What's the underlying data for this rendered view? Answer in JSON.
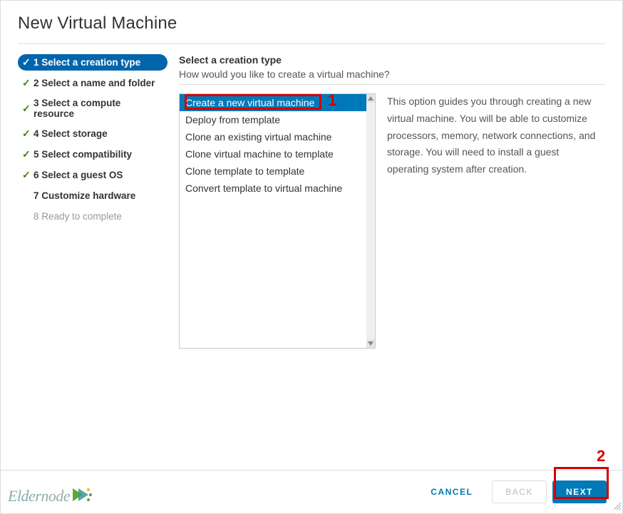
{
  "dialog": {
    "title": "New Virtual Machine"
  },
  "sidebar": {
    "steps": [
      {
        "num": "1",
        "label": "Select a creation type"
      },
      {
        "num": "2",
        "label": "Select a name and folder"
      },
      {
        "num": "3",
        "label": "Select a compute resource"
      },
      {
        "num": "4",
        "label": "Select storage"
      },
      {
        "num": "5",
        "label": "Select compatibility"
      },
      {
        "num": "6",
        "label": "Select a guest OS"
      },
      {
        "num": "7",
        "label": "Customize hardware"
      },
      {
        "num": "8",
        "label": "Ready to complete"
      }
    ]
  },
  "main": {
    "heading": "Select a creation type",
    "subheading": "How would you like to create a virtual machine?",
    "options": [
      "Create a new virtual machine",
      "Deploy from template",
      "Clone an existing virtual machine",
      "Clone virtual machine to template",
      "Clone template to template",
      "Convert template to virtual machine"
    ],
    "description": "This option guides you through creating a new virtual machine. You will be able to customize processors, memory, network connections, and storage. You will need to install a guest operating system after creation."
  },
  "footer": {
    "cancel": "CANCEL",
    "back": "BACK",
    "next": "NEXT"
  },
  "annotations": {
    "a1": "1",
    "a2": "2"
  },
  "watermark": {
    "brand_a": "Elder",
    "brand_b": "node"
  }
}
